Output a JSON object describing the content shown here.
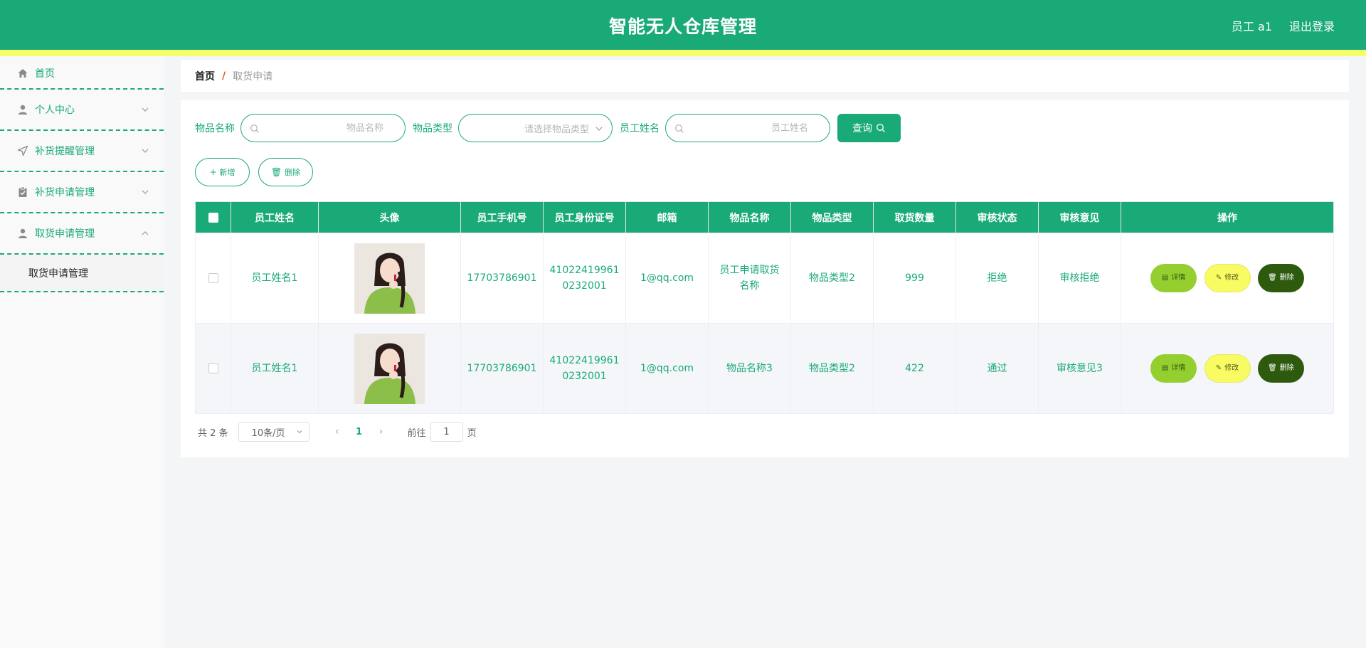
{
  "header": {
    "title": "智能无人仓库管理",
    "user": "员工 a1",
    "logout": "退出登录",
    "colors": {
      "primary": "#1aaa78",
      "stripe": "#f5ff6a"
    }
  },
  "sidebar": {
    "items": [
      {
        "label": "首页",
        "icon": "home-icon"
      },
      {
        "label": "个人中心",
        "icon": "user-icon",
        "expandable": true
      },
      {
        "label": "补货提醒管理",
        "icon": "send-icon",
        "expandable": true
      },
      {
        "label": "补货申请管理",
        "icon": "clipboard-icon",
        "expandable": true
      },
      {
        "label": "取货申请管理",
        "icon": "user-icon",
        "expandable": true,
        "expanded": true
      }
    ],
    "submenu": {
      "label": "取货申请管理"
    }
  },
  "breadcrumb": {
    "home": "首页",
    "separator": "/",
    "current": "取货申请"
  },
  "filters": {
    "item_name_label": "物品名称",
    "item_name_placeholder": "物品名称",
    "item_type_label": "物品类型",
    "item_type_placeholder": "请选择物品类型",
    "employee_name_label": "员工姓名",
    "employee_name_placeholder": "员工姓名",
    "search_label": "查询"
  },
  "actions": {
    "add_label": "新增",
    "delete_label": "删除"
  },
  "table": {
    "columns": [
      "员工姓名",
      "头像",
      "员工手机号",
      "员工身份证号",
      "邮箱",
      "物品名称",
      "物品类型",
      "取货数量",
      "审核状态",
      "审核意见",
      "操作"
    ],
    "rows": [
      {
        "employee_name": "员工姓名1",
        "phone": "17703786901",
        "id_number": "410224199610232001",
        "id_line1": "41022419961",
        "id_line2": "0232001",
        "email": "1@qq.com",
        "item_name": "员工申请取货名称",
        "item_name_line1": "员工申请取货",
        "item_name_line2": "名称",
        "item_type": "物品类型2",
        "quantity": "999",
        "status": "拒绝",
        "opinion": "审核拒绝"
      },
      {
        "employee_name": "员工姓名1",
        "phone": "17703786901",
        "id_number": "410224199610232001",
        "id_line1": "41022419961",
        "id_line2": "0232001",
        "email": "1@qq.com",
        "item_name": "物品名称3",
        "item_name_line1": "物品名称3",
        "item_name_line2": "",
        "item_type": "物品类型2",
        "quantity": "422",
        "status": "通过",
        "opinion": "审核意见3"
      }
    ],
    "op_detail": "详情",
    "op_edit": "修改",
    "op_delete": "删除"
  },
  "pagination": {
    "total": "共 2 条",
    "page_size": "10条/页",
    "current_page": "1",
    "goto_label": "前往",
    "goto_value": "1",
    "goto_unit": "页",
    "prev_icon": "chevron-left-icon",
    "next_icon": "chevron-right-icon"
  }
}
